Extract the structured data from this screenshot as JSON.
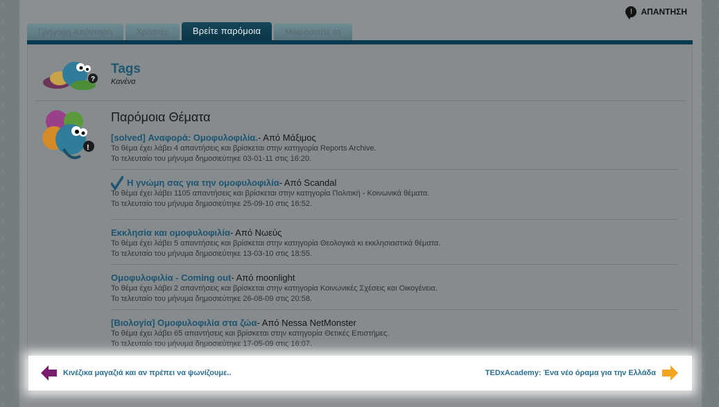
{
  "header": {
    "reply_label": "ΑΠΑΝΤΗΣΗ"
  },
  "tabs": [
    {
      "label": "Γρήγορη Απάντηση"
    },
    {
      "label": "Χρήστες"
    },
    {
      "label": "Βρείτε παρόμοια"
    },
    {
      "label": "Μοιραστείτε το"
    }
  ],
  "tags": {
    "title": "Tags",
    "value": "Κανένα"
  },
  "similar": {
    "title": "Παρόμοια Θέματα",
    "threads": [
      {
        "title": "[solved] Αναφορά: Ομοφυλοφιλία.",
        "by": " - Από Μάξιμος",
        "replies_line": "Το θέμα έχει λάβει 4 απαντήσεις και βρίσκεται στην κατηγορία Reports Archive.",
        "last_post_line": "Το τελευταίο του μήνυμα δημοσιεύτηκε 03-01-11 στις 16:20."
      },
      {
        "title": "Η γνώμη σας για την ομοφυλοφιλία",
        "by": " - Από Scandal",
        "replies_line": "Το θέμα έχει λάβει 1105 απαντήσεις και βρίσκεται στην κατηγορία Πολιτική - Κοινωνικά θέματα.",
        "last_post_line": "Το τελευταίο του μήνυμα δημοσιεύτηκε 25-09-10 στις 16:52."
      },
      {
        "title": "Εκκλησία και ομοφυλοφιλία",
        "by": " - Από Νωεύς",
        "replies_line": "Το θέμα έχει λάβει 5 απαντήσεις και βρίσκεται στην κατηγορία Θεολογικά κι εκκλησιαστικά θέματα.",
        "last_post_line": "Το τελευταίο του μήνυμα δημοσιεύτηκε 13-03-10 στις 18:55."
      },
      {
        "title": "Ομοφυλοφιλία - Coming out",
        "by": " - Από moonlight",
        "replies_line": "Το θέμα έχει λάβει 2 απαντήσεις και βρίσκεται στην κατηγορία Κοινωνικές Σχέσεις και Οικογένεια.",
        "last_post_line": "Το τελευταίο του μήνυμα δημοσιεύτηκε 26-08-09 στις 20:58."
      },
      {
        "title": "[Βιολογία] Ομοφυλοφιλία στα ζώα",
        "by": " - Από Nessa NetMonster",
        "replies_line": "Το θέμα έχει λάβει 65 απαντήσεις και βρίσκεται στην κατηγορία Θετικές Επιστήμες.",
        "last_post_line": "Το τελευταίο του μήνυμα δημοσιεύτηκε 17-05-09 στις 16:07."
      }
    ]
  },
  "footer": {
    "prev_label": "Κινέζικα μαγαζιά και αν πρέπει να ψωνίζουμε..",
    "next_label": "TEDxAcademy: Ένα νέο όραμα για την Ελλάδα"
  },
  "colors": {
    "accent": "#1d5470",
    "tab_active": "#0c3546",
    "prev_arrow": "#7a1d6e",
    "next_arrow": "#f4a521"
  }
}
